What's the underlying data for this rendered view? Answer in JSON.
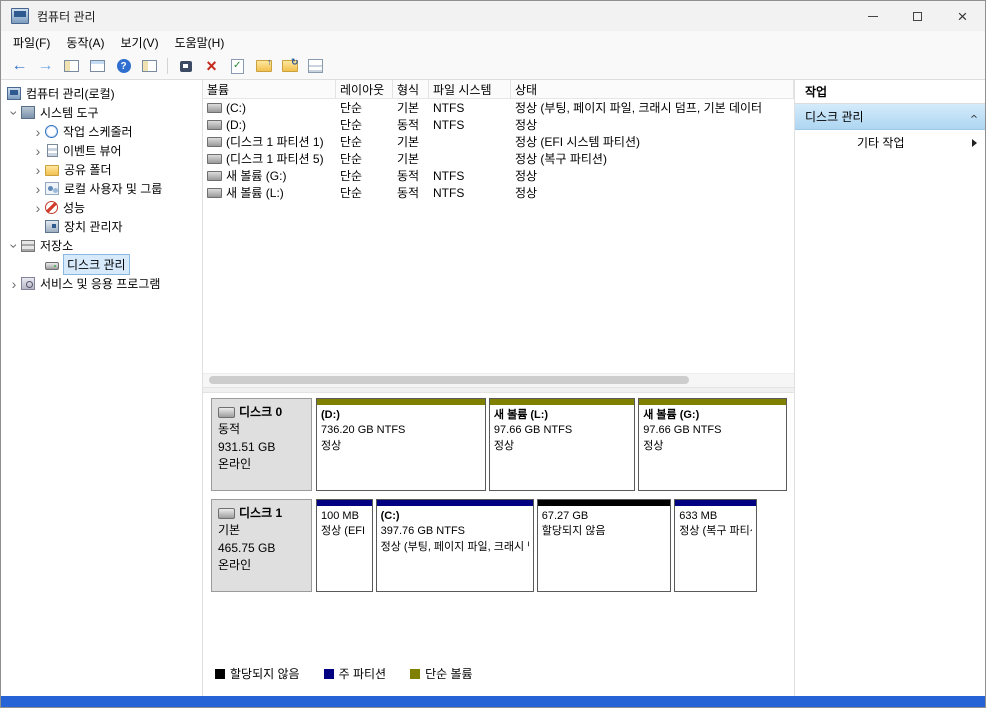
{
  "window": {
    "title": "컴퓨터 관리"
  },
  "menubar": {
    "file": "파일(F)",
    "action": "동작(A)",
    "view": "보기(V)",
    "help": "도움말(H)"
  },
  "toolbar": {
    "icon_names": [
      "back-icon",
      "forward-icon",
      "show-console-tree-icon",
      "export-list-icon",
      "help-icon",
      "show-action-pane-icon",
      "action-menu-icon",
      "delete-icon",
      "check-disk-icon",
      "open-folder-icon",
      "refresh-icon",
      "properties-list-icon"
    ]
  },
  "tree": {
    "root": "컴퓨터 관리(로컬)",
    "system_tools": "시스템 도구",
    "task_scheduler": "작업 스케줄러",
    "event_viewer": "이벤트 뷰어",
    "shared_folders": "공유 폴더",
    "local_users_groups": "로컬 사용자 및 그룹",
    "performance": "성능",
    "device_manager": "장치 관리자",
    "storage": "저장소",
    "disk_management": "디스크 관리",
    "services_apps": "서비스 및 응용 프로그램"
  },
  "volumes": {
    "headers": {
      "volume": "볼륨",
      "layout": "레이아웃",
      "type": "형식",
      "fs": "파일 시스템",
      "status": "상태"
    },
    "rows": [
      {
        "volume": "(C:)",
        "layout": "단순",
        "type": "기본",
        "fs": "NTFS",
        "status": "정상 (부팅, 페이지 파일, 크래시 덤프, 기본 데이터"
      },
      {
        "volume": "(D:)",
        "layout": "단순",
        "type": "동적",
        "fs": "NTFS",
        "status": "정상"
      },
      {
        "volume": "(디스크 1 파티션 1)",
        "layout": "단순",
        "type": "기본",
        "fs": "",
        "status": "정상 (EFI 시스템 파티션)"
      },
      {
        "volume": "(디스크 1 파티션 5)",
        "layout": "단순",
        "type": "기본",
        "fs": "",
        "status": "정상 (복구 파티션)"
      },
      {
        "volume": "새 볼륨 (G:)",
        "layout": "단순",
        "type": "동적",
        "fs": "NTFS",
        "status": "정상"
      },
      {
        "volume": "새 볼륨 (L:)",
        "layout": "단순",
        "type": "동적",
        "fs": "NTFS",
        "status": "정상"
      }
    ]
  },
  "disks": [
    {
      "name": "디스크 0",
      "type": "동적",
      "size": "931.51 GB",
      "status": "온라인",
      "partitions": [
        {
          "label": "(D:)",
          "size": "736.20 GB NTFS",
          "status": "정상",
          "color": "#808000"
        },
        {
          "label": "새 볼륨  (L:)",
          "size": "97.66 GB NTFS",
          "status": "정상",
          "color": "#808000"
        },
        {
          "label": "새 볼륨  (G:)",
          "size": "97.66 GB NTFS",
          "status": "정상",
          "color": "#808000"
        }
      ]
    },
    {
      "name": "디스크 1",
      "type": "기본",
      "size": "465.75 GB",
      "status": "온라인",
      "partitions": [
        {
          "label": "",
          "size": "100 MB",
          "status": "정상 (EFI 시스템 파티션)",
          "color": "#000080"
        },
        {
          "label": "(C:)",
          "size": "397.76 GB NTFS",
          "status": "정상 (부팅, 페이지 파일, 크래시 덤프, 기본 데이터",
          "color": "#000080"
        },
        {
          "label": "",
          "size": "67.27 GB",
          "status": "할당되지 않음",
          "color": "#000000"
        },
        {
          "label": "",
          "size": "633 MB",
          "status": "정상 (복구 파티션)",
          "color": "#000080"
        }
      ]
    }
  ],
  "legend": {
    "unallocated": {
      "label": "할당되지 않음",
      "color": "#000000"
    },
    "primary": {
      "label": "주 파티션",
      "color": "#000080"
    },
    "simple": {
      "label": "단순 볼륨",
      "color": "#808000"
    }
  },
  "actions": {
    "title": "작업",
    "disk_management": "디스크 관리",
    "more_actions": "기타 작업"
  }
}
